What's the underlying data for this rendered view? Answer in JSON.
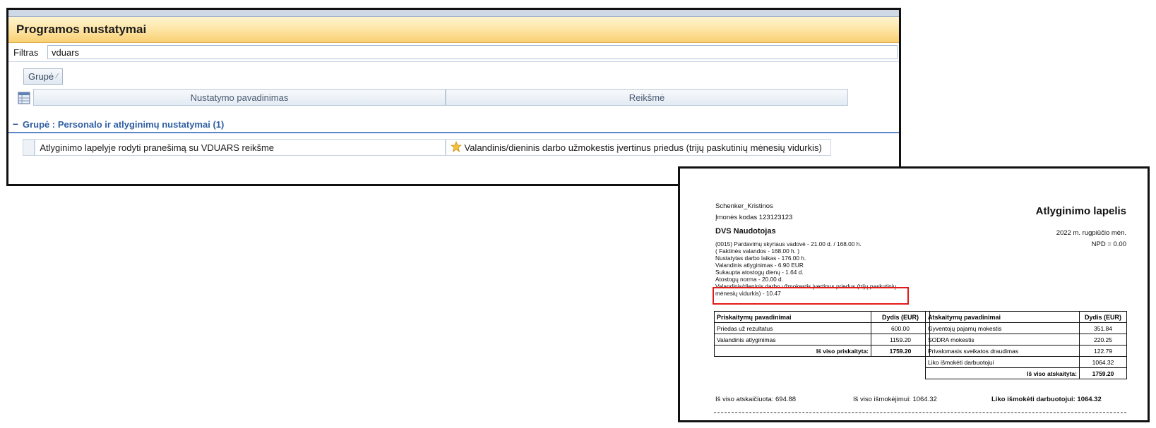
{
  "settings_window": {
    "title": "Programos nustatymai",
    "filter": {
      "label": "Filtras",
      "value": "vduars"
    },
    "group_chip": {
      "label": "Grupė"
    },
    "columns": [
      "Nustatymo pavadinimas",
      "Reikšmė"
    ],
    "group": {
      "label": "Grupė : Personalo ir atlyginimų nustatymai (1)"
    },
    "rows": [
      {
        "name": "Atlyginimo lapelyje rodyti pranešimą su VDUARS reikšme",
        "value": "Valandinis/dieninis darbo užmokestis įvertinus priedus (trijų paskutinių mėnesių vidurkis)"
      }
    ],
    "colors": {
      "title_gradient": "#f8cf72",
      "group_text": "#2f5fa3",
      "highlight": "#e41a1a"
    }
  },
  "payslip": {
    "company": "Schenker_Kristinos",
    "company_code": "Įmonės kodas 123123123",
    "title": "Atlyginimo lapelis",
    "employee": "DVS Naudotojas",
    "period": "2022 m. rugpiūčio mėn.",
    "npd": "NPD = 0.00",
    "details": [
      "(0015) Pardavimų skyriaus vadovė - 21.00 d. / 168.00 h.",
      "( Faktinės valandos - 168.00 h. )",
      "Nustatytas darbo laikas - 176.00 h.",
      "Valandinis atlyginimas - 6.90 EUR",
      "Sukaupta atostogų dienų - 1.64 d.",
      "Atostogų norma - 20.00 d."
    ],
    "highlight_lines": [
      "Valandinis/dieninis darbo užmokestis įvertinus priedus (trijų paskutinių",
      "mėnesių vidurkis) - 10.47"
    ],
    "accruals": {
      "headers": [
        "Priskaitymų pavadinimai",
        "Dydis (EUR)"
      ],
      "rows": [
        [
          "Priedas už rezultatus",
          "600.00"
        ],
        [
          "Valandinis atlyginimas",
          "1159.20"
        ]
      ],
      "total_label": "Iš viso priskaityta:",
      "total_value": "1759.20"
    },
    "deductions": {
      "headers": [
        "Atskaitymų pavadinimai",
        "Dydis (EUR)"
      ],
      "rows": [
        [
          "Gyventojų pajamų mokestis",
          "351.84"
        ],
        [
          "SODRA mokestis",
          "220.25"
        ],
        [
          "Privalomasis sveikatos draudimas",
          "122.79"
        ],
        [
          "Liko išmokėti darbuotojui",
          "1064.32"
        ]
      ],
      "total_label": "Iš viso atskaityta:",
      "total_value": "1759.20"
    },
    "footer": {
      "deducted": "Iš viso atskaičiuota: 694.88",
      "paid": "Iš viso išmokėjimui: 1064.32",
      "remaining_label": "Liko išmokėti darbuotojui:",
      "remaining_value": "1064.32"
    }
  }
}
